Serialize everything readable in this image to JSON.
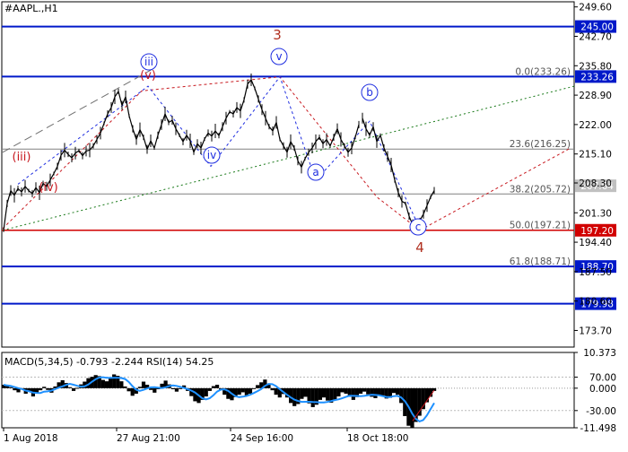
{
  "symbol_label": "#AAPL.,H1",
  "indicator_label": "MACD(5,34,5) -0.793 -2.244 RSI(14) 54.25",
  "colors": {
    "background": "#ffffff",
    "frame": "#000000",
    "price": "#000000",
    "level_blue": "#0019c9",
    "level_red": "#d10000",
    "fib_line": "#808080",
    "wave_blue": "#1f2ee0",
    "wave_red": "#c8191f",
    "wave3_label": "#b03020",
    "trend_green": "#1a7a1a",
    "trend_gray": "#707070",
    "macd_line": "#1e90ff",
    "macd_hist": "#000000",
    "tag_gray": "#c0c0c0"
  },
  "chart_data": [
    {
      "type": "line",
      "title": "#AAPL.,H1",
      "ylim": [
        169.8,
        250.8
      ],
      "y_ticks": [
        "249.60",
        "242.70",
        "235.80",
        "228.90",
        "222.00",
        "215.10",
        "208.30",
        "201.30",
        "194.40",
        "187.50",
        "180.60",
        "173.70"
      ],
      "x_ticks": [
        "1 Aug 2018",
        "27 Aug 21:00",
        "24 Sep 16:00",
        "18 Oct 18:00"
      ],
      "series": [
        {
          "values": [
            197.2,
            203.5,
            206.5,
            205.4,
            207.0,
            206.2,
            207.5,
            206.5,
            205.8,
            207.2,
            206.0,
            208.2,
            207.5,
            209.0,
            210.5,
            212.2,
            214.8,
            216.0,
            215.0,
            214.2,
            215.3,
            215.9,
            214.7,
            215.8,
            216.0,
            217.0,
            218.5,
            220.0,
            222.3,
            224.5,
            226.0,
            228.5,
            229.8,
            226.5,
            228.5,
            224.0,
            221.0,
            218.5,
            220.8,
            219.0,
            216.2,
            218.2,
            216.5,
            219.5,
            222.0,
            224.5,
            222.5,
            223.0,
            221.0,
            219.5,
            218.0,
            219.5,
            218.2,
            215.5,
            217.5,
            216.5,
            218.6,
            220.0,
            219.3,
            220.5,
            219.4,
            221.5,
            223.5,
            225.0,
            224.5,
            226.0,
            225.2,
            227.8,
            231.5,
            232.5,
            230.5,
            228.0,
            225.5,
            223.5,
            221.5,
            220.5,
            222.5,
            218.5,
            217.0,
            215.5,
            218.0,
            216.5,
            213.5,
            212.0,
            214.0,
            215.5,
            216.5,
            218.0,
            219.0,
            217.5,
            218.5,
            217.0,
            219.0,
            221.0,
            218.5,
            217.0,
            215.5,
            216.5,
            219.0,
            222.0,
            223.5,
            221.0,
            219.5,
            221.5,
            218.0,
            219.5,
            216.5,
            214.5,
            212.5,
            209.0,
            206.0,
            204.0,
            203.5,
            200.5,
            198.5,
            198.0,
            199.5,
            201.0,
            203.0,
            205.0,
            206.5
          ],
          "gaps_after_index": [
            99
          ]
        }
      ],
      "tags": [
        {
          "label": "245.00",
          "price": 245.0,
          "style": "blue"
        },
        {
          "label": "233.26",
          "price": 233.26,
          "style": "blue"
        },
        {
          "label": "207.64",
          "price": 207.64,
          "style": "gray"
        },
        {
          "label": "197.20",
          "price": 197.2,
          "style": "red"
        },
        {
          "label": "188.70",
          "price": 188.7,
          "style": "blue"
        },
        {
          "label": "179.98",
          "price": 179.98,
          "style": "blue"
        }
      ],
      "fibonacci": [
        {
          "label": "0.0(233.26)",
          "price": 233.26
        },
        {
          "label": "23.6(216.25)",
          "price": 216.25
        },
        {
          "label": "38.2(205.72)",
          "price": 205.72
        },
        {
          "label": "50.0(197.21)",
          "price": 197.21
        },
        {
          "label": "61.8(188.71)",
          "price": 188.71
        }
      ],
      "wave_labels": [
        {
          "label": "(iii)",
          "style": "red",
          "circled": false
        },
        {
          "label": "(iv)",
          "style": "red",
          "circled": false
        },
        {
          "label": "(v)",
          "style": "red",
          "circled": false
        },
        {
          "label": "iii",
          "style": "blue",
          "circled": true
        },
        {
          "label": "iv",
          "style": "blue",
          "circled": true
        },
        {
          "label": "v",
          "style": "blue",
          "circled": true
        },
        {
          "label": "3",
          "style": "brown",
          "circled": false
        },
        {
          "label": "a",
          "style": "blue",
          "circled": true
        },
        {
          "label": "b",
          "style": "blue",
          "circled": true
        },
        {
          "label": "c",
          "style": "blue",
          "circled": true
        },
        {
          "label": "4",
          "style": "brown",
          "circled": false
        }
      ]
    },
    {
      "type": "bar",
      "title": "MACD(5,34,5) -0.793 -2.244 RSI(14) 54.25",
      "ylim": [
        -11.498,
        10.373
      ],
      "y_ticks": [
        "10.373",
        "70.00",
        "0.000",
        "-30.00",
        "-11.498"
      ],
      "series": [
        {
          "name": "MACD",
          "values": [
            1.0,
            0.6,
            0.3,
            -0.6,
            -1.2,
            -0.4,
            -1.6,
            -0.9,
            -2.4,
            -1.5,
            -0.6,
            0.4,
            -0.5,
            -1.3,
            0.5,
            1.7,
            2.3,
            1.5,
            0.3,
            -0.8,
            0.1,
            1.1,
            1.9,
            2.9,
            3.3,
            3.8,
            3.5,
            2.4,
            2.0,
            3.2,
            4.0,
            3.6,
            2.0,
            0.5,
            -0.9,
            -2.2,
            -1.6,
            0.4,
            1.9,
            1.0,
            -0.5,
            -1.3,
            -0.3,
            1.3,
            2.2,
            1.1,
            -0.3,
            -1.0,
            -0.1,
            0.8,
            -0.8,
            -2.3,
            -3.8,
            -4.3,
            -3.4,
            -2.4,
            -0.8,
            0.6,
            1.0,
            -0.5,
            -1.9,
            -3.1,
            -3.5,
            -2.6,
            -1.9,
            -1.2,
            -2.1,
            -1.6,
            -0.2,
            0.9,
            1.7,
            2.5,
            1.3,
            -0.6,
            -1.9,
            -2.7,
            -1.7,
            -2.7,
            -4.3,
            -5.2,
            -4.6,
            -3.1,
            -2.5,
            -4.4,
            -5.5,
            -4.8,
            -3.4,
            -2.7,
            -3.6,
            -4.2,
            -3.3,
            -2.4,
            -1.2,
            -1.6,
            -2.5,
            -3.4,
            -2.6,
            -1.6,
            -1.0,
            -1.8,
            -2.5,
            -2.9,
            -2.2,
            -2.1,
            -3.0,
            -2.8,
            -1.4,
            -1.9,
            -4.3,
            -8.1,
            -10.9,
            -11.5,
            -9.8,
            -8.0,
            -6.1,
            -4.1,
            -2.5,
            -0.8
          ]
        }
      ]
    }
  ]
}
